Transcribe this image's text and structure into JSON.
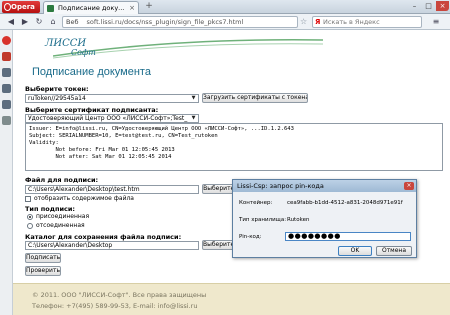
{
  "browser": {
    "app_name": "Opera",
    "tab_title": "Подписание доку...",
    "tab_close": "×",
    "new_tab": "+",
    "url_prefix": "Веб",
    "url": "soft.lissi.ru/docs/nss_plugin/sign_file_pkcs7.html",
    "search_placeholder": "Искать в Яндекс",
    "search_engine_letter": "Я",
    "win_min": "–",
    "win_max": "□",
    "win_close": "×",
    "nav_back": "◀",
    "nav_fwd": "▶",
    "nav_reload": "↻",
    "nav_home": "⌂",
    "star": "☆",
    "menu": "≡"
  },
  "page": {
    "logo_main": "ЛИССИ",
    "logo_sub": "Софт",
    "title": "Подписание документа",
    "token": {
      "label": "Выберите токен:",
      "value": "ruToken//29545a14",
      "load_button": "Загрузить сертификаты с токена"
    },
    "certificate": {
      "label": "Выберите сертификат подписанта:",
      "value": "Удостоверяющий Центр ООО «ЛИССИ-Софт»;Test_",
      "details": [
        "Issuer: E=info@lissi.ru, CN=Удостоверяющий Центр ООО «ЛИССИ-Софт», ...ID.1.2.643",
        "Subject: SERIALNUMBER=10, E=test@test.ru, CN=Test_rutoken",
        "Validity:",
        "        Not before: Fri Mar 01 12:05:45 2013",
        "        Not after: Sat Mar 01 12:05:45 2014"
      ]
    },
    "file": {
      "label": "Файл для подписи:",
      "value": "C:\\Users\\Alexander\\Desktop\\test.htm",
      "button": "Выберите фай",
      "show_content": "отобразить содержимое файла"
    },
    "sign_type": {
      "label": "Тип подписи:",
      "options": [
        "присоединенная",
        "отсоединенная"
      ],
      "selected": "присоединенная"
    },
    "folder": {
      "label": "Каталог для сохранения файла подписи:",
      "value": "C:\\Users\\Alexander\\Desktop",
      "button": "Выберите каталог"
    },
    "sign_button": "Подписать",
    "verify_button": "Проверить",
    "footer": {
      "line1": "© 2011. ООО \"ЛИССИ-Софт\". Все права защищены",
      "line2": "Телефон: +7(495) 589-99-53, E-mail: info@lissi.ru"
    }
  },
  "dialog": {
    "title": "Lissi-Csp: запрос pin-кода",
    "close": "×",
    "container_label": "Контейнер:",
    "container_value": "cea9fabb-b1dd-4512-a831-2048d971e91f",
    "storage_label": "Тип хранилища:",
    "storage_value": "Rutoken",
    "pin_label": "Pin-код:",
    "pin_value": "●●●●●●●●",
    "ok": "OK",
    "cancel": "Отмена"
  },
  "colors": {
    "accent": "#1a6b8a",
    "footer_bg": "#efe8cc",
    "opera_red": "#c41a1a"
  }
}
